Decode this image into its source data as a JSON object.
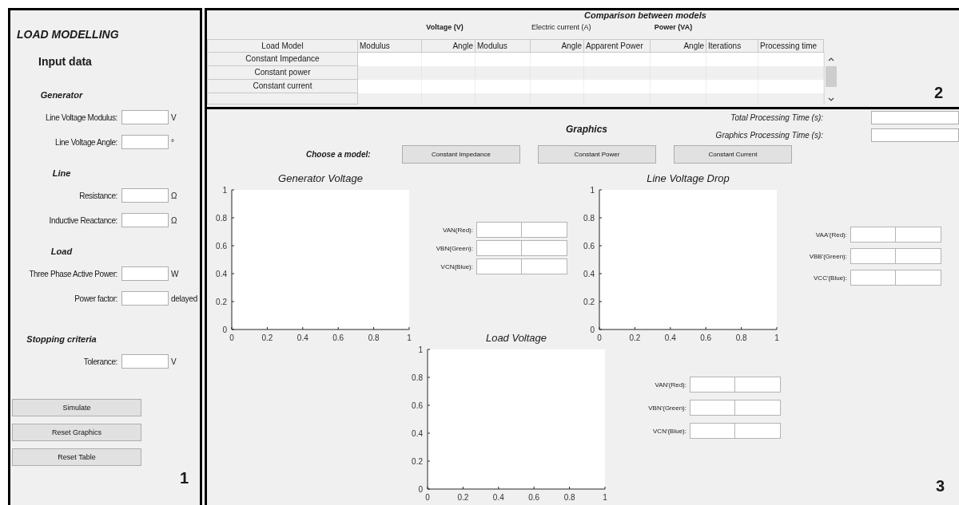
{
  "left_panel": {
    "title": "LOAD MODELLING",
    "subtitle": "Input data",
    "sections": [
      {
        "heading": "Generator",
        "fields": [
          {
            "label": "Line Voltage Modulus:",
            "unit": "V"
          },
          {
            "label": "Line Voltage Angle:",
            "unit": "°"
          }
        ]
      },
      {
        "heading": "Line",
        "fields": [
          {
            "label": "Resistance:",
            "unit": "Ω"
          },
          {
            "label": "Inductive Reactance:",
            "unit": "Ω"
          }
        ]
      },
      {
        "heading": "Load",
        "fields": [
          {
            "label": "Three Phase Active Power:",
            "unit": "W"
          },
          {
            "label": "Power factor:",
            "unit": "delayed"
          }
        ]
      },
      {
        "heading": "Stopping criteria",
        "fields": [
          {
            "label": "Tolerance:",
            "unit": "V"
          }
        ]
      }
    ],
    "buttons": [
      "Simulate",
      "Reset Graphics",
      "Reset Table"
    ],
    "panel_number": "1"
  },
  "table_panel": {
    "title": "Comparison between models",
    "groups": [
      "Voltage (V)",
      "Electric current (A)",
      "Power (VA)"
    ],
    "columns": [
      "Load Model",
      "Modulus",
      "Angle",
      "Modulus",
      "Angle",
      "Apparent Power",
      "Angle",
      "Iterations",
      "Processing time"
    ],
    "rows": [
      "Constant Impedance",
      "Constant power",
      "Constant current"
    ],
    "panel_number": "2"
  },
  "graphics_panel": {
    "title": "Graphics",
    "times": [
      "Total Processing Time (s):",
      "Graphics Processing Time (s):"
    ],
    "choose_label": "Choose a model:",
    "model_buttons": [
      "Constant Impedance",
      "Constant Power",
      "Constant Current"
    ],
    "plots": [
      {
        "readouts": [
          "VAN(Red):",
          "VBN(Green):",
          "VCN(Blue):"
        ],
        "chart_data": {
          "type": "line",
          "title": "Generator Voltage",
          "xlim": [
            0,
            1
          ],
          "ylim": [
            0,
            1
          ],
          "xticks": [
            0,
            0.2,
            0.4,
            0.6,
            0.8,
            1
          ],
          "yticks": [
            0,
            0.2,
            0.4,
            0.6,
            0.8,
            1
          ]
        }
      },
      {
        "readouts": [
          "VAA'(Red):",
          "VBB'(Green):",
          "VCC'(Blue):"
        ],
        "chart_data": {
          "type": "line",
          "title": "Line Voltage Drop",
          "xlim": [
            0,
            1
          ],
          "ylim": [
            0,
            1
          ],
          "xticks": [
            0,
            0.2,
            0.4,
            0.6,
            0.8,
            1
          ],
          "yticks": [
            0,
            0.2,
            0.4,
            0.6,
            0.8,
            1
          ]
        }
      },
      {
        "readouts": [
          "VAN'(Red):",
          "VBN'(Green):",
          "VCN'(Blue):"
        ],
        "chart_data": {
          "type": "line",
          "title": "Load Voltage",
          "xlim": [
            0,
            1
          ],
          "ylim": [
            0,
            1
          ],
          "xticks": [
            0,
            0.2,
            0.4,
            0.6,
            0.8,
            1
          ],
          "yticks": [
            0,
            0.2,
            0.4,
            0.6,
            0.8,
            1
          ]
        }
      }
    ],
    "panel_number": "3"
  }
}
